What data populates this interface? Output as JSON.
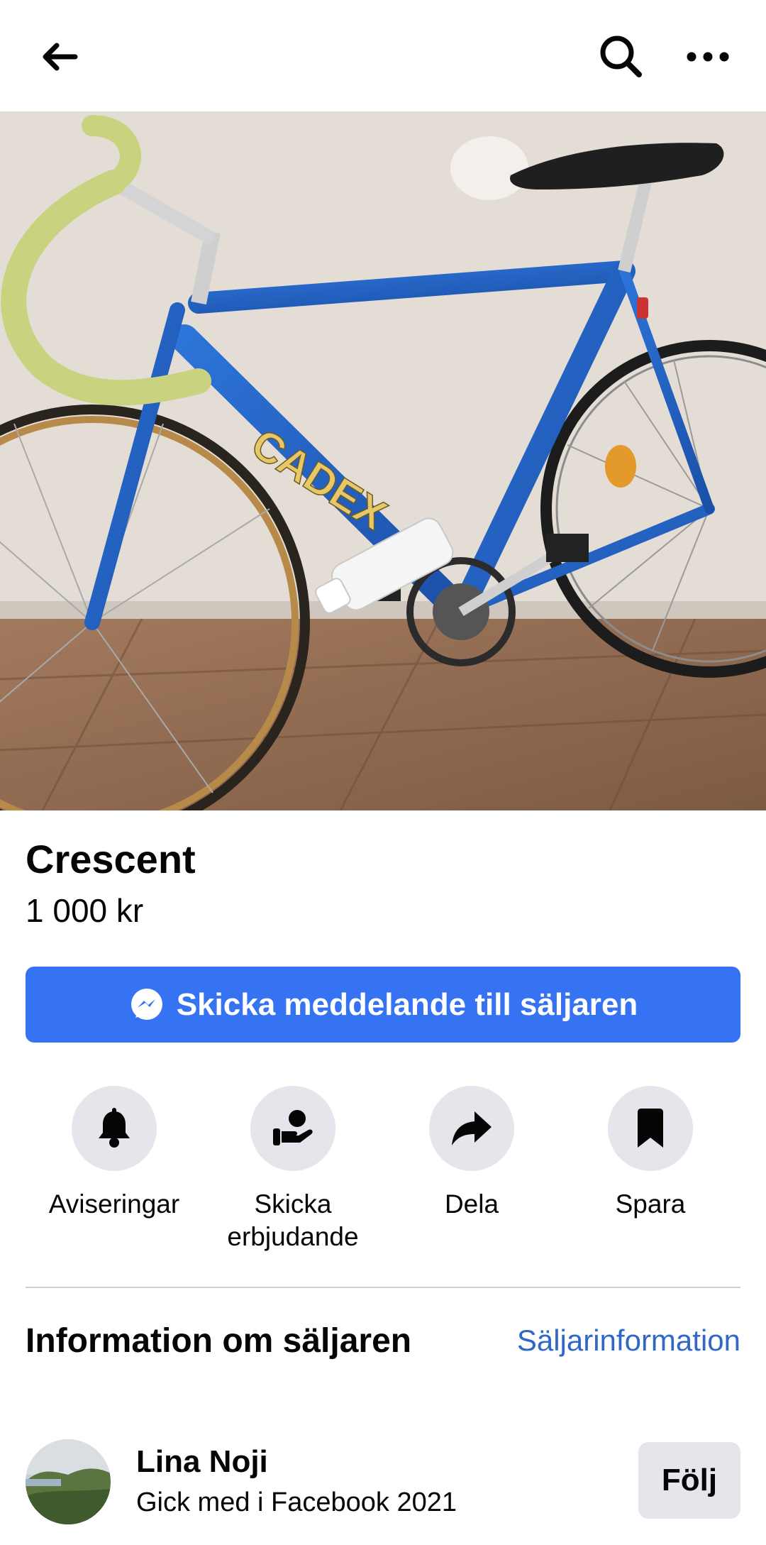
{
  "topbar": {
    "back_icon": "arrow-left-icon",
    "search_icon": "search-icon",
    "more_icon": "more-horizontal-icon"
  },
  "listing": {
    "title": "Crescent",
    "price": "1 000 kr",
    "photo_subject": "CADEX"
  },
  "cta": {
    "label": "Skicka meddelande till säljaren",
    "icon": "messenger-icon",
    "color": "#3573f3"
  },
  "actions": [
    {
      "label": "Aviseringar",
      "icon": "bell-icon"
    },
    {
      "label_line1": "Skicka",
      "label_line2": "erbjudande",
      "icon": "offer-hand-icon"
    },
    {
      "label": "Dela",
      "icon": "share-icon"
    },
    {
      "label": "Spara",
      "icon": "bookmark-icon"
    }
  ],
  "seller_section": {
    "title": "Information om säljaren",
    "link": "Säljarinformation"
  },
  "seller": {
    "name": "Lina Noji",
    "joined": "Gick med i Facebook 2021",
    "follow_label": "Följ"
  }
}
